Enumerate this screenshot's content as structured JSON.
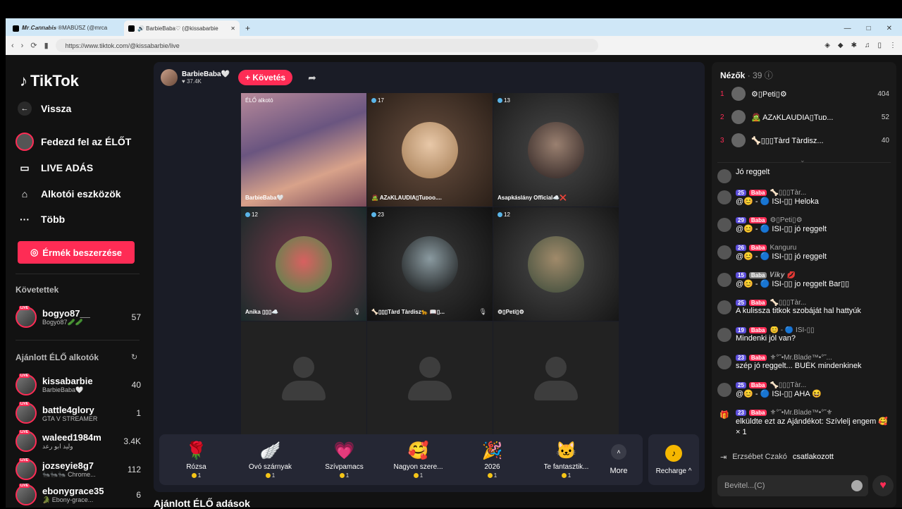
{
  "browser": {
    "tabs": [
      {
        "title": "𝑴𝒓.𝑪𝒂𝒏𝒏𝒂𝒃𝒊𝒔 ®MABÚSZ (@mrca"
      },
      {
        "title": "🔊 BarbieBaba♡ (@kissabarbie"
      }
    ],
    "url": "https://www.tiktok.com/@kissabarbie/live"
  },
  "sidebar": {
    "logo": "TikTok",
    "back": "Vissza",
    "nav": [
      "Fedezd fel az ÉLŐT",
      "LIVE ADÁS",
      "Alkotói eszközök",
      "Több"
    ],
    "coin_button": "Érmék beszerzése",
    "following_title": "Követettek",
    "following": [
      {
        "name": "bogyo87__",
        "sub": "Bogyó87🥒🥒",
        "count": "57"
      }
    ],
    "recommended_title": "Ajánlott ÉLŐ alkotók",
    "recommended": [
      {
        "name": "kissabarbie",
        "sub": "BarbieBaba🤍",
        "count": "40"
      },
      {
        "name": "battle4glory",
        "sub": "GTA V STREAMER",
        "count": "1"
      },
      {
        "name": "waleed1984m",
        "sub": "وليد ابو رعد",
        "count": "3.4K"
      },
      {
        "name": "jozseyie8g7",
        "sub": "🐜🐜🐜 Chrome...",
        "count": "112"
      },
      {
        "name": "ebonygrace35",
        "sub": "🐊 Ebony-grace...",
        "count": "6"
      }
    ]
  },
  "stream": {
    "host_name": "BarbieBaba🤍",
    "host_likes": "♥ 37.4K",
    "follow": "+ Követés",
    "cells": [
      {
        "badge": "ÉLŐ alkotó",
        "name": "BarbieBaba🤍"
      },
      {
        "badge": "17",
        "name": "🧟 AZʌKLAUDIA▯Tuᴅᴏᴏ...."
      },
      {
        "badge": "13",
        "name": "Asapkáslány Official☁️❌"
      },
      {
        "badge": "12",
        "name": "Anika ▯▯▯☁️"
      },
      {
        "badge": "23",
        "name": "🦴▯▯▯Tàrd Tàrdisz🐆 📖▯..."
      },
      {
        "badge": "12",
        "name": "⚙▯Peti▯⚙"
      }
    ],
    "gifts": [
      {
        "name": "Rózsa",
        "icon": "🌹",
        "price": "1"
      },
      {
        "name": "Óvó szárnyak",
        "icon": "🪽",
        "price": "1"
      },
      {
        "name": "Szívpamacs",
        "icon": "💗",
        "price": "1"
      },
      {
        "name": "Nagyon szere...",
        "icon": "🥰",
        "price": "1"
      },
      {
        "name": "2026",
        "icon": "🎉",
        "price": "1"
      },
      {
        "name": "Te fantasztik...",
        "icon": "🐱",
        "price": "1"
      }
    ],
    "more": "More",
    "recharge": "Recharge ^",
    "recommended_lives": "Ajánlott ÉLŐ adások"
  },
  "chat": {
    "viewers_title": "Nézők",
    "viewers_count": "· 39",
    "viewers": [
      {
        "rank": "1",
        "name": "⚙▯Peti▯⚙",
        "score": "404"
      },
      {
        "rank": "2",
        "name": "🧟 AZʌKLAUDIA▯Tuᴅ...",
        "score": "52"
      },
      {
        "rank": "3",
        "name": "🦴▯▯▯Tàrd Tàrdisz...",
        "score": "40"
      }
    ],
    "messages": [
      {
        "lvl": "",
        "badge": "",
        "user": "",
        "text": "Jó reggelt"
      },
      {
        "lvl": "25",
        "badge": "Baba",
        "user": "🦴▯▯▯Tàr...",
        "text": "@😊 - 🔵 ISI-▯▯ Heloka"
      },
      {
        "lvl": "29",
        "badge": "Baba",
        "user": "⚙▯Peti▯⚙",
        "text": "@😊 - 🔵 ISI-▯▯ jó reggelt"
      },
      {
        "lvl": "26",
        "badge": "Baba",
        "user": "Kanguru",
        "text": "@😊 - 🔵 ISI-▯▯ jó reggelt"
      },
      {
        "lvl": "15",
        "badge": "Baba",
        "user": "𝑽𝒊𝒌𝒚 💋",
        "text": "@😊 - 🔵 ISI-▯▯ jo reggelt Bar▯▯"
      },
      {
        "lvl": "25",
        "badge": "Baba",
        "user": "🦴▯▯▯Tàr...",
        "text": "A kulissza titkok szobáját hal hattyúk"
      },
      {
        "lvl": "19",
        "badge": "Baba",
        "user": "😊 - 🔵 ISI-▯▯",
        "text": "Mindenki jól van?"
      },
      {
        "lvl": "23",
        "badge": "Baba",
        "user": "⚜°˜•Mr.Blade™•°˜...",
        "text": "szép jó reggelt... BUÉK mindenkinek"
      },
      {
        "lvl": "25",
        "badge": "Baba",
        "user": "🦴▯▯▯Tàr...",
        "text": "@😊 - 🔵 ISI-▯▯ AHA 😆"
      },
      {
        "lvl": "23",
        "badge": "Baba",
        "user": "⚜°˜•Mr.Blade™•°˜⚜",
        "text": "elküldte ezt az Ajándékot: Szívlelj engem 🥰 × 1"
      }
    ],
    "joined_user": "Erzsébet Czakó",
    "joined_text": "csatlakozott",
    "input_placeholder": "Bevitel...(C)"
  }
}
